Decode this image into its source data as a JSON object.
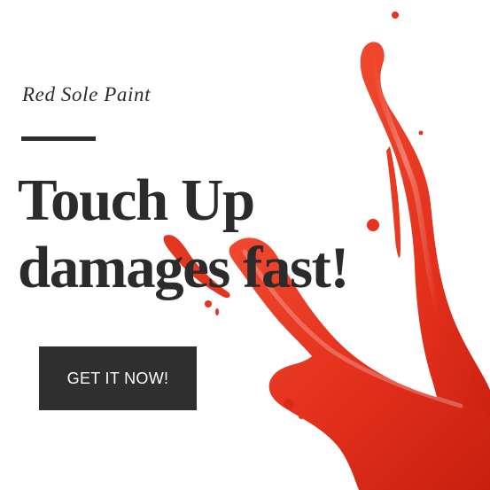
{
  "brand": "Red Sole Paint",
  "headline": {
    "line1": "Touch Up",
    "line2": "damages fast!"
  },
  "cta": {
    "label": "GET IT NOW!"
  },
  "colors": {
    "text": "#2b2b2b",
    "button_bg": "#2f2f2f",
    "paint_red": "#e8321e"
  },
  "decor": {
    "image": "red-paint-splash"
  }
}
